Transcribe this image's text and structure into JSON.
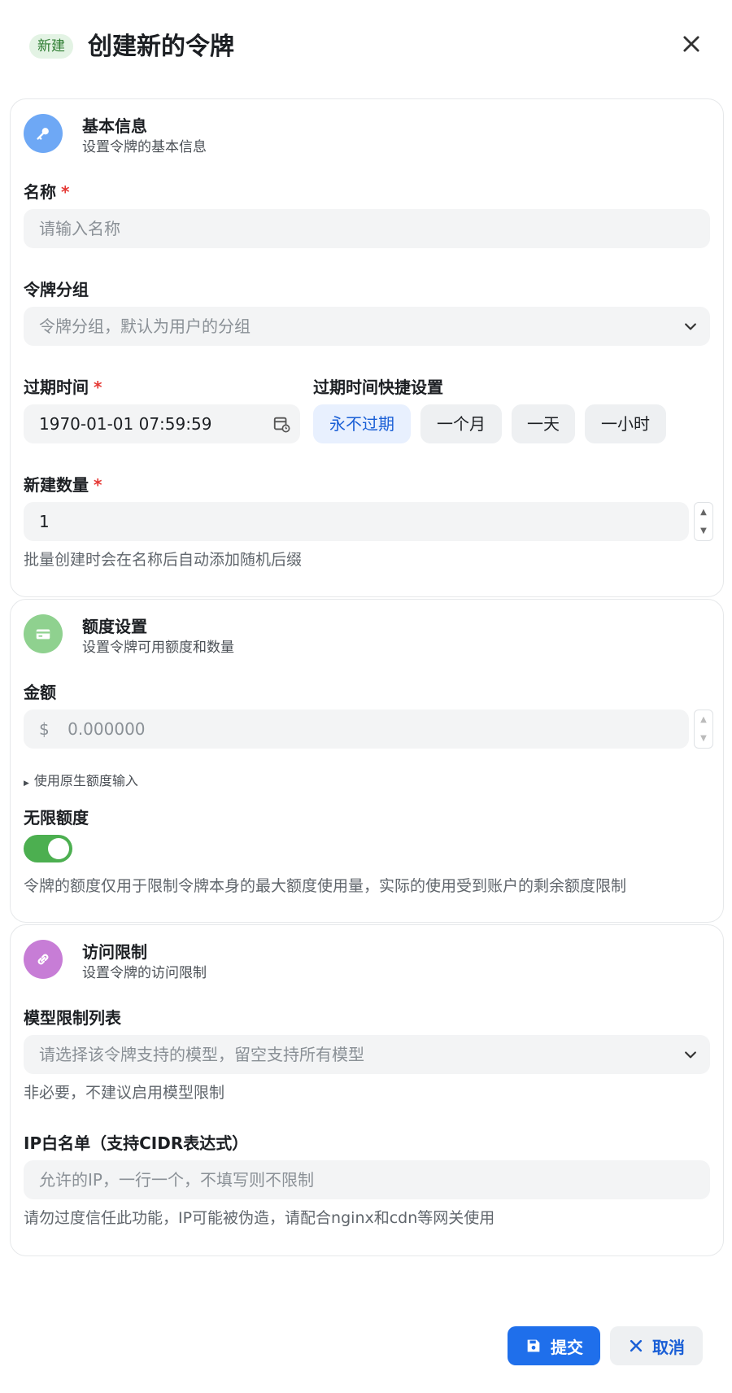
{
  "header": {
    "badge": "新建",
    "title": "创建新的令牌"
  },
  "basic": {
    "title": "基本信息",
    "subtitle": "设置令牌的基本信息",
    "name_label": "名称",
    "name_placeholder": "请输入名称",
    "group_label": "令牌分组",
    "group_placeholder": "令牌分组，默认为用户的分组",
    "expire_label": "过期时间",
    "expire_value": "1970-01-01 07:59:59",
    "quick_label": "过期时间快捷设置",
    "quick_options": [
      "永不过期",
      "一个月",
      "一天",
      "一小时"
    ],
    "count_label": "新建数量",
    "count_value": "1",
    "count_help": "批量创建时会在名称后自动添加随机后缀"
  },
  "quota": {
    "title": "额度设置",
    "subtitle": "设置令牌可用额度和数量",
    "amount_label": "金额",
    "currency": "$",
    "amount_placeholder": "0.000000",
    "raw_toggle": "使用原生额度输入",
    "unlimited_label": "无限额度",
    "unlimited_on": true,
    "unlimited_help": "令牌的额度仅用于限制令牌本身的最大额度使用量，实际的使用受到账户的剩余额度限制"
  },
  "access": {
    "title": "访问限制",
    "subtitle": "设置令牌的访问限制",
    "models_label": "模型限制列表",
    "models_placeholder": "请选择该令牌支持的模型，留空支持所有模型",
    "models_help": "非必要，不建议启用模型限制",
    "ip_label": "IP白名单（支持CIDR表达式）",
    "ip_placeholder": "允许的IP，一行一个，不填写则不限制",
    "ip_help": "请勿过度信任此功能，IP可能被伪造，请配合nginx和cdn等网关使用"
  },
  "footer": {
    "submit": "提交",
    "cancel": "取消"
  },
  "colors": {
    "primary": "#1f6feb",
    "toggle_on": "#4caf50",
    "required": "#e53935"
  }
}
